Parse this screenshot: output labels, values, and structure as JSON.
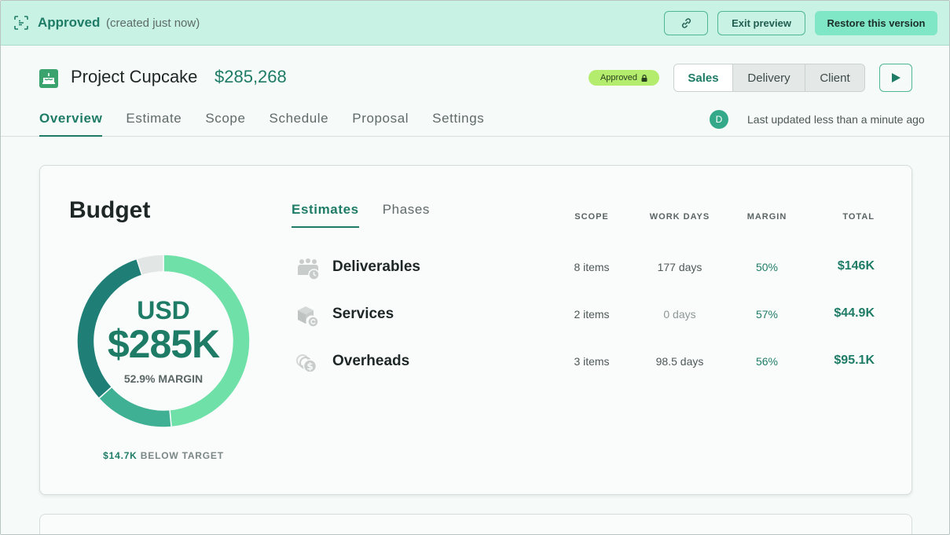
{
  "banner": {
    "status": "Approved",
    "status_sub": "(created just now)",
    "exit_label": "Exit preview",
    "restore_label": "Restore this version"
  },
  "project": {
    "name": "Project Cupcake",
    "amount": "$285,268",
    "badge": "Approved",
    "views": [
      "Sales",
      "Delivery",
      "Client"
    ],
    "active_view": "Sales"
  },
  "tabs": [
    "Overview",
    "Estimate",
    "Scope",
    "Schedule",
    "Proposal",
    "Settings"
  ],
  "active_tab": "Overview",
  "user": {
    "avatar_initial": "D",
    "last_updated": "Last updated less than a minute ago"
  },
  "budget": {
    "title": "Budget",
    "currency": "USD",
    "amount": "$285K",
    "margin": "52.9% MARGIN",
    "below_target_amount": "$14.7K",
    "below_target_text": "BELOW TARGET",
    "subtabs": [
      "Estimates",
      "Phases"
    ],
    "columns": {
      "scope": "SCOPE",
      "work_days": "WORK DAYS",
      "margin": "MARGIN",
      "total": "TOTAL"
    },
    "rows": [
      {
        "name": "Deliverables",
        "scope": "8 items",
        "work_days": "177 days",
        "margin": "50%",
        "total": "$146K"
      },
      {
        "name": "Services",
        "scope": "2 items",
        "work_days": "0 days",
        "margin": "57%",
        "total": "$44.9K"
      },
      {
        "name": "Overheads",
        "scope": "3 items",
        "work_days": "98.5 days",
        "margin": "56%",
        "total": "$95.1K"
      }
    ],
    "ring_segments": [
      {
        "label": "Deliverables",
        "share": 0.512,
        "color": "#6fe0a8"
      },
      {
        "label": "Services",
        "share": 0.157,
        "color": "#3fb094"
      },
      {
        "label": "Overheads",
        "share": 0.333,
        "color": "#1f7f77"
      }
    ],
    "ring_gap_color": "#e2e6e5"
  }
}
